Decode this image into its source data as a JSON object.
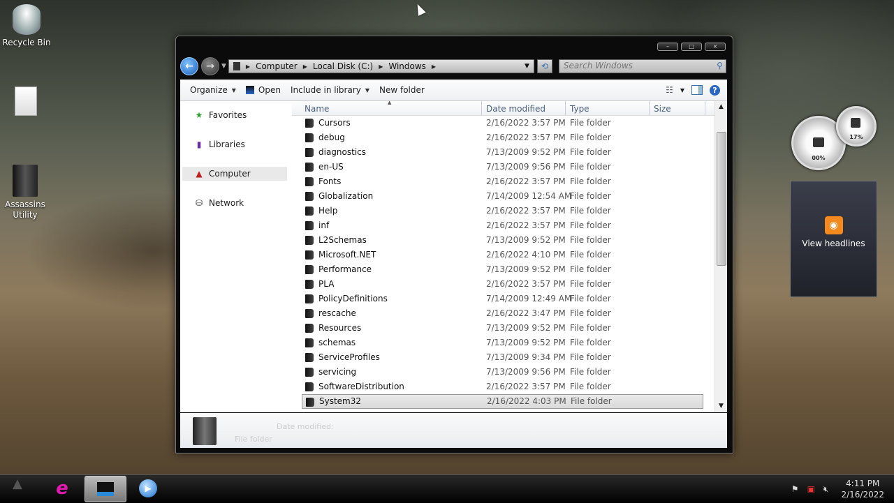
{
  "desktop": {
    "icons": [
      {
        "label": "Recycle Bin"
      },
      {
        "label": ""
      },
      {
        "label": "Assassins Utility"
      }
    ]
  },
  "window": {
    "address": {
      "crumbs": [
        "Computer",
        "Local Disk (C:)",
        "Windows"
      ]
    },
    "search": {
      "placeholder": "Search Windows"
    },
    "toolbar": {
      "organize": "Organize",
      "open": "Open",
      "include": "Include in library",
      "new_folder": "New folder"
    },
    "nav": [
      {
        "label": "Favorites",
        "icon": "star-icon"
      },
      {
        "label": "Libraries",
        "icon": "library-icon"
      },
      {
        "label": "Computer",
        "icon": "computer-icon",
        "selected": true
      },
      {
        "label": "Network",
        "icon": "network-icon"
      }
    ],
    "columns": {
      "name": "Name",
      "date": "Date modified",
      "type": "Type",
      "size": "Size"
    },
    "files": [
      {
        "name": "Cursors",
        "date": "2/16/2022 3:57 PM",
        "type": "File folder"
      },
      {
        "name": "debug",
        "date": "2/16/2022 3:57 PM",
        "type": "File folder"
      },
      {
        "name": "diagnostics",
        "date": "7/13/2009 9:52 PM",
        "type": "File folder"
      },
      {
        "name": "en-US",
        "date": "7/13/2009 9:56 PM",
        "type": "File folder"
      },
      {
        "name": "Fonts",
        "date": "2/16/2022 3:57 PM",
        "type": "File folder"
      },
      {
        "name": "Globalization",
        "date": "7/14/2009 12:54 AM",
        "type": "File folder"
      },
      {
        "name": "Help",
        "date": "2/16/2022 3:57 PM",
        "type": "File folder"
      },
      {
        "name": "inf",
        "date": "2/16/2022 3:57 PM",
        "type": "File folder"
      },
      {
        "name": "L2Schemas",
        "date": "7/13/2009 9:52 PM",
        "type": "File folder"
      },
      {
        "name": "Microsoft.NET",
        "date": "2/16/2022 4:10 PM",
        "type": "File folder"
      },
      {
        "name": "Performance",
        "date": "7/13/2009 9:52 PM",
        "type": "File folder"
      },
      {
        "name": "PLA",
        "date": "2/16/2022 3:57 PM",
        "type": "File folder"
      },
      {
        "name": "PolicyDefinitions",
        "date": "7/14/2009 12:49 AM",
        "type": "File folder"
      },
      {
        "name": "rescache",
        "date": "2/16/2022 3:47 PM",
        "type": "File folder"
      },
      {
        "name": "Resources",
        "date": "7/13/2009 9:52 PM",
        "type": "File folder"
      },
      {
        "name": "schemas",
        "date": "7/13/2009 9:52 PM",
        "type": "File folder"
      },
      {
        "name": "ServiceProfiles",
        "date": "7/13/2009 9:34 PM",
        "type": "File folder"
      },
      {
        "name": "servicing",
        "date": "7/13/2009 9:56 PM",
        "type": "File folder"
      },
      {
        "name": "SoftwareDistribution",
        "date": "2/16/2022 3:57 PM",
        "type": "File folder"
      },
      {
        "name": "System32",
        "date": "2/16/2022 4:03 PM",
        "type": "File folder",
        "selected": true
      }
    ],
    "details": {
      "date_label": "Date modified:",
      "type": "File folder"
    }
  },
  "gadgets": {
    "cpu_meter": {
      "cpu": "00%",
      "memory": "17%"
    },
    "headlines": {
      "label": "View headlines"
    }
  },
  "taskbar": {
    "clock_time": "4:11 PM",
    "clock_date": "2/16/2022"
  },
  "colors": {
    "accent": "#2b66c2",
    "rss": "#f48a1e"
  }
}
